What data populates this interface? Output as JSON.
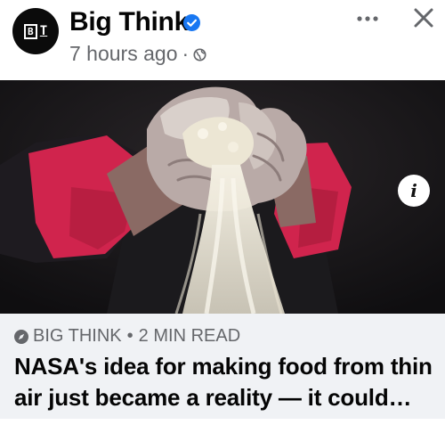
{
  "post": {
    "page_name": "Big Think",
    "logo_letters": "B",
    "logo_t": "T",
    "time_ago": "7 hours ago",
    "meta_separator": "·",
    "verified_icon": "verified-badge-icon",
    "privacy_icon": "globe-icon"
  },
  "actions": {
    "more_label": "•••",
    "close_label": "✕",
    "info_label": "i"
  },
  "image": {
    "description_icon": "info-icon"
  },
  "link_preview": {
    "source": "BIG THINK",
    "separator": "•",
    "read_time": "2 MIN READ",
    "headline": "NASA's idea for making food from thin air just became a reality — it could fe..."
  },
  "colors": {
    "verified_blue": "#1877f2",
    "meta_gray": "#65676b",
    "preview_bg": "#f0f2f5",
    "sleeve_red": "#d0244d"
  }
}
